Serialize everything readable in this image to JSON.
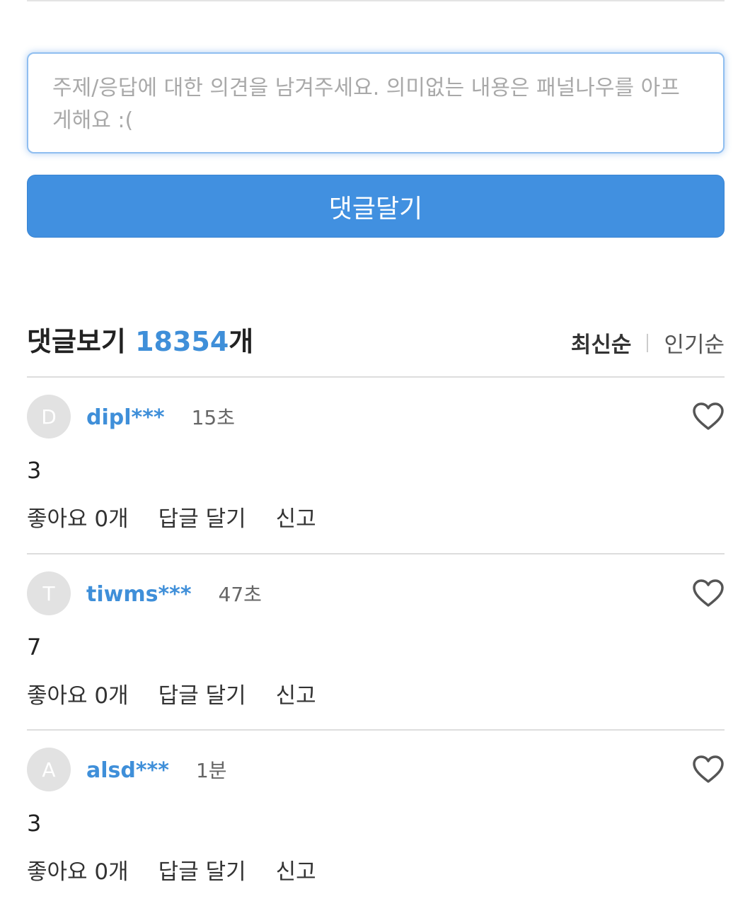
{
  "form": {
    "placeholder": "주제/응답에 대한 의견을 남겨주세요. 의미없는 내용은 패널나우를 아프게해요 :(",
    "submit_label": "댓글달기"
  },
  "comments_header": {
    "title": "댓글보기",
    "count": "18354",
    "count_suffix": "개",
    "sort_latest": "최신순",
    "sort_popular": "인기순"
  },
  "comments": [
    {
      "avatar_letter": "D",
      "username": "dipl***",
      "time": "15초",
      "body": "3",
      "like_label": "좋아요 0개",
      "reply_label": "답글 달기",
      "report_label": "신고"
    },
    {
      "avatar_letter": "T",
      "username": "tiwms***",
      "time": "47초",
      "body": "7",
      "like_label": "좋아요 0개",
      "reply_label": "답글 달기",
      "report_label": "신고"
    },
    {
      "avatar_letter": "A",
      "username": "alsd***",
      "time": "1분",
      "body": "3",
      "like_label": "좋아요 0개",
      "reply_label": "답글 달기",
      "report_label": "신고"
    }
  ],
  "icons": {
    "heart": "heart-outline-icon"
  },
  "colors": {
    "accent": "#4190e0",
    "username": "#3f8fd9",
    "avatar_bg": "#e2e2e2"
  }
}
